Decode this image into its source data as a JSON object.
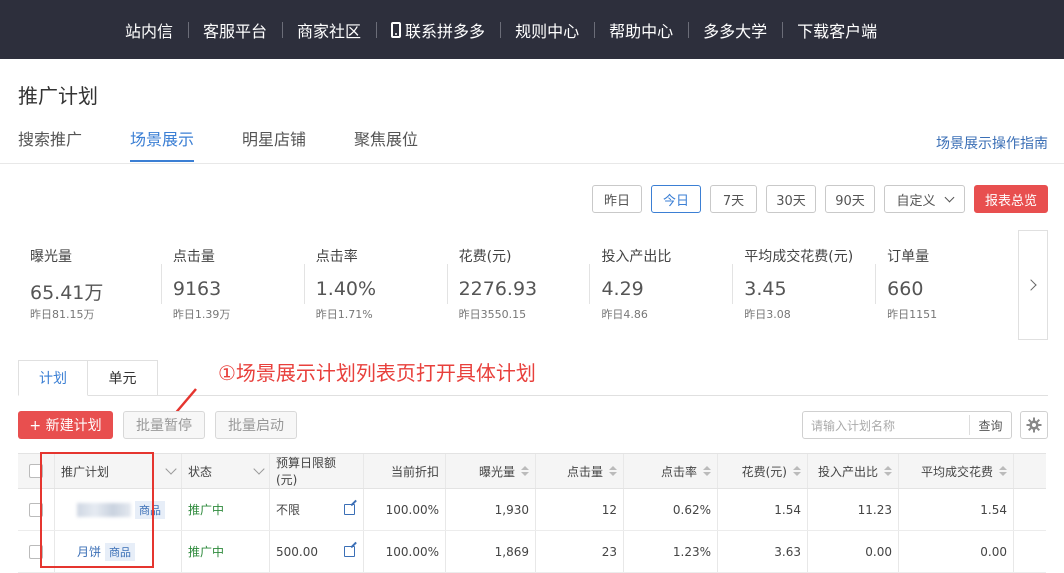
{
  "topnav": {
    "items": [
      "站内信",
      "客服平台",
      "商家社区",
      "联系拼多多",
      "规则中心",
      "帮助中心",
      "多多大学",
      "下载客户端"
    ]
  },
  "page": {
    "title": "推广计划"
  },
  "tabs": [
    "搜索推广",
    "场景展示",
    "明星店铺",
    "聚焦展位"
  ],
  "active_tab": "场景展示",
  "guide_link": "场景展示操作指南",
  "date_buttons": [
    "昨日",
    "今日",
    "7天",
    "30天",
    "90天"
  ],
  "active_date": "今日",
  "custom_label": "自定义",
  "report_label": "报表总览",
  "stats": [
    {
      "label": "曝光量",
      "value": "65.41万",
      "prev": "昨日81.15万"
    },
    {
      "label": "点击量",
      "value": "9163",
      "prev": "昨日1.39万"
    },
    {
      "label": "点击率",
      "value": "1.40%",
      "prev": "昨日1.71%"
    },
    {
      "label": "花费(元)",
      "value": "2276.93",
      "prev": "昨日3550.15"
    },
    {
      "label": "投入产出比",
      "value": "4.29",
      "prev": "昨日4.86"
    },
    {
      "label": "平均成交花费(元)",
      "value": "3.45",
      "prev": "昨日3.08"
    },
    {
      "label": "订单量",
      "value": "660",
      "prev": "昨日1151"
    }
  ],
  "subtabs": [
    "计划",
    "单元"
  ],
  "annotation": "①场景展示计划列表页打开具体计划",
  "toolbar": {
    "new_plan": "+ 新建计划",
    "batch_pause": "批量暂停",
    "batch_start": "批量启动",
    "search_placeholder": "请输入计划名称",
    "search_button": "查询"
  },
  "table": {
    "headers": [
      "推广计划",
      "状态",
      "预算日限额(元)",
      "当前折扣",
      "曝光量",
      "点击量",
      "点击率",
      "花费(元)",
      "投入产出比",
      "平均成交花费"
    ],
    "rows": [
      {
        "name": "",
        "tag": "商品",
        "status": "推广中",
        "budget": "不限",
        "discount": "100.00%",
        "impressions": "1,930",
        "clicks": "12",
        "ctr": "0.62%",
        "spend": "1.54",
        "roi": "11.23",
        "avg_cost": "1.54"
      },
      {
        "name": "月饼",
        "tag": "商品",
        "status": "推广中",
        "budget": "500.00",
        "discount": "100.00%",
        "impressions": "1,869",
        "clicks": "23",
        "ctr": "1.23%",
        "spend": "3.63",
        "roi": "0.00",
        "avg_cost": "0.00"
      }
    ]
  }
}
